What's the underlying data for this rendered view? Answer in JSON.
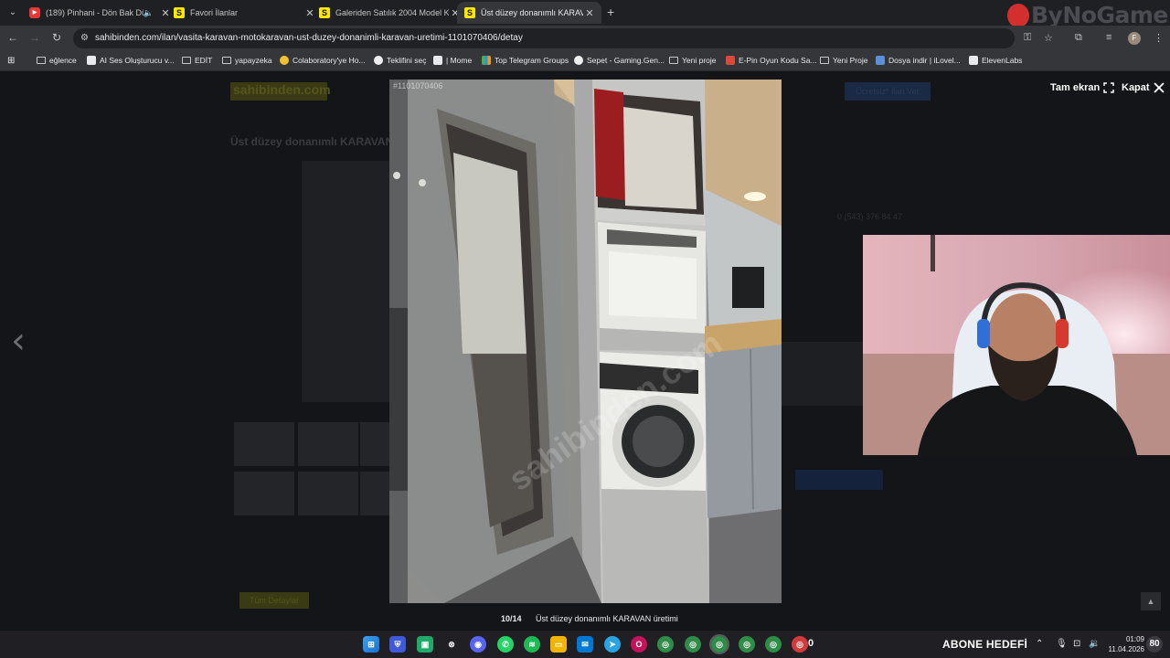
{
  "tabs": [
    {
      "title": "(189) Pinhani - Dön Bak Dü",
      "favicon": "youtube-icon",
      "has_audio": true,
      "active": false
    },
    {
      "title": "Favori İlanlar",
      "favicon": "sahibinden-icon",
      "active": false
    },
    {
      "title": "Galeriden Satılık 2004 Model K",
      "favicon": "sahibinden-icon",
      "active": false
    },
    {
      "title": "Üst düzey donanımlı KARAVAN",
      "favicon": "sahibinden-icon",
      "active": true
    }
  ],
  "address_bar": {
    "url": "sahibinden.com/ilan/vasita-karavan-motokaravan-ust-duzey-donanimli-karavan-uretimi-1101070406/detay"
  },
  "bookmarks": [
    {
      "label": "eğlence",
      "icon": "folder-icon"
    },
    {
      "label": "AI Ses Oluşturucu v...",
      "icon": "ai-icon"
    },
    {
      "label": "EDİT",
      "icon": "folder-icon"
    },
    {
      "label": "yapayzeka",
      "icon": "folder-icon"
    },
    {
      "label": "Colaboratory'ye Ho...",
      "icon": "colab-icon"
    },
    {
      "label": "Teklifini seç",
      "icon": "site-icon"
    },
    {
      "label": "| Mome",
      "icon": "mome-icon"
    },
    {
      "label": "Top Telegram Groups",
      "icon": "chart-icon"
    },
    {
      "label": "Sepet - Gaming.Gen...",
      "icon": "site-icon"
    },
    {
      "label": "Yeni proje",
      "icon": "folder-icon"
    },
    {
      "label": "E-Pin Oyun Kodu Sa...",
      "icon": "epin-icon"
    },
    {
      "label": "Yeni Proje",
      "icon": "folder-icon"
    },
    {
      "label": "Dosya indir | iLovel...",
      "icon": "ilovepdf-icon"
    },
    {
      "label": "ElevenLabs",
      "icon": "elevenlabs-icon"
    }
  ],
  "brand_overlay": {
    "text": "ByNoGame"
  },
  "lightbox": {
    "listing_id": "#1101070406",
    "fullscreen_label": "Tam ekran",
    "close_label": "Kapat",
    "counter": "10/14",
    "caption": "Üst düzey donanımlı KARAVAN üretimi",
    "watermark": "sahibinden.com"
  },
  "page_underlay": {
    "logo": "sahibinden.com",
    "title": "Üst düzey donanımlı KARAVAN",
    "phone": "0 (543) 376 84 47",
    "button_yellow": "Tüm Detaylar",
    "button_blue": "Ücretsiz* İlan Ver"
  },
  "taskbar": {
    "abone_label": "ABONE HEDEFİ",
    "abone_count": "0",
    "time": "01:09",
    "date": "11.04.2026",
    "notifications": "80"
  },
  "colors": {
    "accent_yellow": "#ffe800",
    "brand_red": "#d32f2f",
    "chrome_bg": "#35363a",
    "overlay_bg": "#141518"
  }
}
